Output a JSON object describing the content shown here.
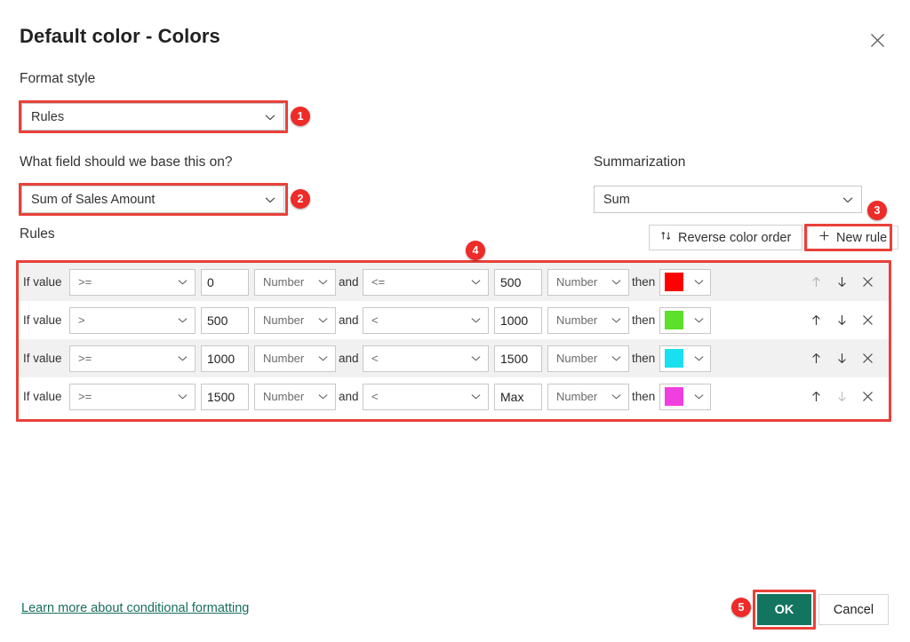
{
  "dialog": {
    "title": "Default color - Colors",
    "close_icon": "close-icon"
  },
  "format_style": {
    "label": "Format style",
    "value": "Rules",
    "chevron_icon": "chevron-down-icon"
  },
  "base_field": {
    "label": "What field should we base this on?",
    "value": "Sum of Sales Amount",
    "chevron_icon": "chevron-down-icon"
  },
  "summarization": {
    "label": "Summarization",
    "value": "Sum",
    "chevron_icon": "chevron-down-icon"
  },
  "rules_section": {
    "label": "Rules",
    "reverse_color_order_label": "Reverse color order",
    "reverse_icon": "sort-updown-icon",
    "new_rule_label": "New rule",
    "new_rule_icon": "plus-icon"
  },
  "rule_labels": {
    "if_value": "If value",
    "and": "and",
    "then": "then",
    "move_up_icon": "arrow-up-icon",
    "move_down_icon": "arrow-down-icon",
    "delete_icon": "close-x-icon"
  },
  "rules": [
    {
      "left_operator": ">=",
      "left_value": "0",
      "left_type": "Number",
      "right_operator": "<=",
      "right_value": "500",
      "right_type": "Number",
      "color": "#FF0000",
      "up_enabled": false,
      "down_enabled": true
    },
    {
      "left_operator": ">",
      "left_value": "500",
      "left_type": "Number",
      "right_operator": "<",
      "right_value": "1000",
      "right_type": "Number",
      "color": "#5CE02A",
      "up_enabled": true,
      "down_enabled": true
    },
    {
      "left_operator": ">=",
      "left_value": "1000",
      "left_type": "Number",
      "right_operator": "<",
      "right_value": "1500",
      "right_type": "Number",
      "color": "#19E0F0",
      "up_enabled": true,
      "down_enabled": true
    },
    {
      "left_operator": ">=",
      "left_value": "1500",
      "left_type": "Number",
      "right_operator": "<",
      "right_value": "Max",
      "right_type": "Number",
      "color": "#F03FDF",
      "up_enabled": true,
      "down_enabled": false
    }
  ],
  "footer": {
    "learn_link": "Learn more about conditional formatting",
    "ok_label": "OK",
    "cancel_label": "Cancel"
  },
  "annotations": {
    "badges": [
      "1",
      "2",
      "3",
      "4",
      "5"
    ],
    "highlight_color": "#e8413a"
  },
  "colors": {
    "accent_green": "#13755f",
    "annotation_red": "#e8413a",
    "badge_red": "#ee2b28",
    "link_green": "#186e5c"
  }
}
